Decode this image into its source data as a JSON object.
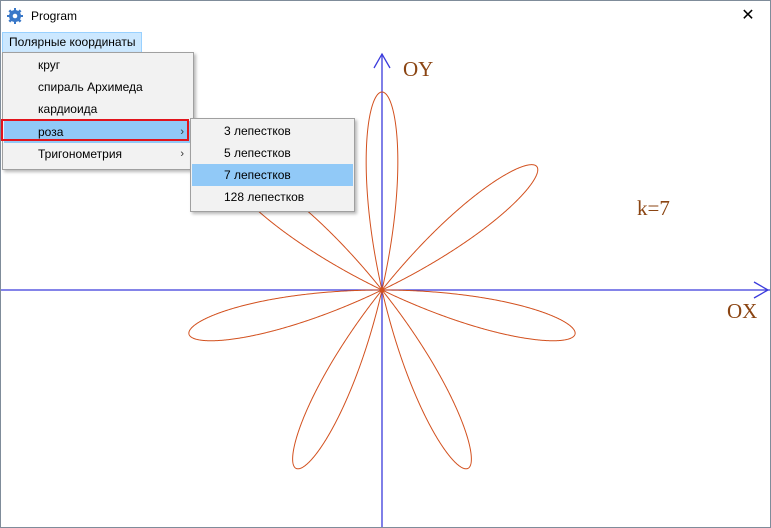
{
  "window": {
    "title": "Program",
    "close_glyph": "✕",
    "app_icon": "gear-icon"
  },
  "menubar": {
    "top_menu": "Полярные координаты"
  },
  "dropdown": {
    "items": [
      {
        "label": "круг",
        "submenu": false
      },
      {
        "label": "спираль Архимеда",
        "submenu": false
      },
      {
        "label": "кардиоида",
        "submenu": false
      },
      {
        "label": "роза",
        "submenu": true,
        "highlighted": true
      },
      {
        "label": "Тригонометрия",
        "submenu": true
      }
    ],
    "arrow_glyph": "›"
  },
  "submenu": {
    "items": [
      {
        "label": "3 лепестков"
      },
      {
        "label": "5 лепестков"
      },
      {
        "label": "7 лепестков",
        "highlighted": true
      },
      {
        "label": "128 лепестков"
      }
    ]
  },
  "plot": {
    "axis_x_label": "OX",
    "axis_y_label": "OY",
    "k_label": "k=7",
    "petals": 7,
    "axis_color": "#3b3bdc",
    "curve_color": "#d2501e",
    "label_color": "#8b4513"
  },
  "colors": {
    "menu_highlight": "#91c9f7",
    "menubar_active": "#cce8ff",
    "selection_outline": "#e2141c"
  }
}
